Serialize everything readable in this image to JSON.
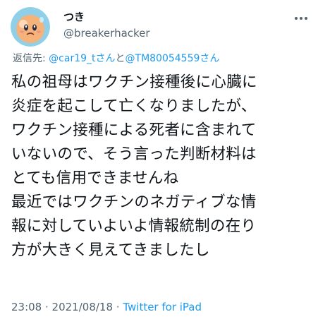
{
  "user": {
    "display_name": "つき",
    "handle": "@breakerhacker"
  },
  "reply": {
    "prefix": "返信先: ",
    "mention_1": "@car19_tさん",
    "conjunction": "と",
    "mention_2": "@TM80054559さん"
  },
  "tweet": {
    "lines": [
      "私の祖母はワクチン接種後に心臓に",
      "炎症を起こして亡くなりましたが、",
      "ワクチン接種による死者に含まれて",
      "いないので、そう言った判断材料は",
      "とても信用できませんね",
      "最近ではワクチンのネガティブな情",
      "報に対していよいよ情報統制の在り",
      "方が大きく見えてきましたし"
    ]
  },
  "meta": {
    "time": "23:08",
    "separator_1": " · ",
    "date": "2021/08/18",
    "separator_2": " · ",
    "client": "Twitter for iPad"
  },
  "colors": {
    "text": "#0f1419",
    "secondary": "#536471",
    "link": "#1d9bf0",
    "avatar_bg": "#8fd0e8",
    "avatar_face": "#f5b27a"
  },
  "icons": {
    "avatar": "kirby-style-cartoon-avatar",
    "more": "more-dots-icon"
  }
}
